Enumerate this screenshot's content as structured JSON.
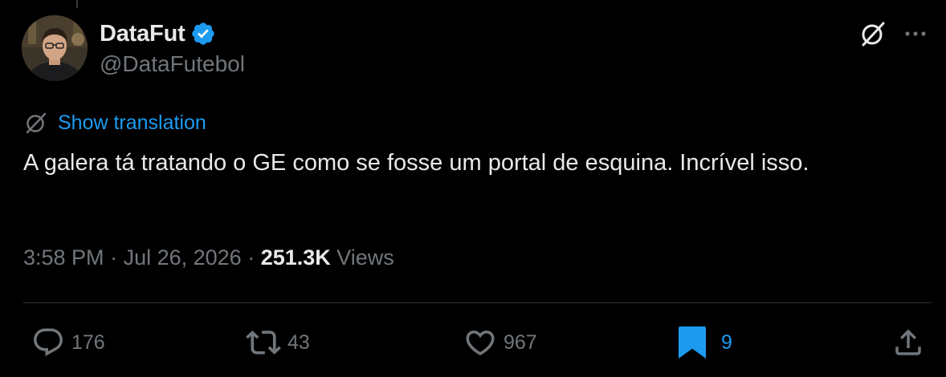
{
  "author": {
    "display_name": "DataFut",
    "handle": "@DataFutebol",
    "verified": true
  },
  "translate": {
    "label": "Show translation"
  },
  "tweet": {
    "text": "A galera tá tratando o GE como se fosse um portal de esquina. Incrível isso."
  },
  "meta": {
    "time": "3:58 PM",
    "separator_1": " · ",
    "date": "Jul 26, 2026",
    "separator_2": " · ",
    "views_count": "251.3K",
    "views_label": " Views"
  },
  "actions": {
    "reply_count": "176",
    "retweet_count": "43",
    "like_count": "967",
    "bookmark_count": "9"
  },
  "icons": {
    "verified": "verified-badge-icon",
    "grok": "grok-icon",
    "more": "more-icon",
    "translate": "translate-icon",
    "reply": "reply-icon",
    "retweet": "retweet-icon",
    "like": "heart-icon",
    "bookmark": "bookmark-icon",
    "share": "share-icon"
  },
  "colors": {
    "background": "#000000",
    "text_primary": "#e7e9ea",
    "text_secondary": "#71767b",
    "accent": "#1d9bf0",
    "divider": "#2f3336"
  }
}
